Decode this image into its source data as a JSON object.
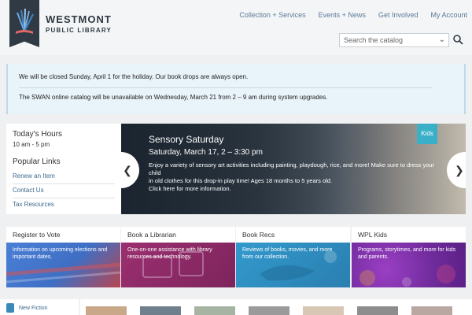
{
  "header": {
    "logo_title": "WESTMONT",
    "logo_subtitle": "PUBLIC LIBRARY",
    "nav": [
      "Collection + Services",
      "Events + News",
      "Get Involved",
      "My Account"
    ],
    "search_placeholder": "Search the catalog"
  },
  "alert": {
    "line1": "We will be closed Sunday, April 1 for the holiday. Our book drops are always open.",
    "line2": "The SWAN online catalog will be unavailable on Wednesday, March 21 from 2 – 9 am during system upgrades."
  },
  "sidebar": {
    "hours_title": "Today's Hours",
    "hours": "10 am - 5 pm",
    "links_title": "Popular Links",
    "links": [
      "Renew an Item",
      "Contact Us",
      "Tax Resources"
    ]
  },
  "carousel": {
    "title": "Sensory Saturday",
    "date": "Saturday, March 17, 2 – 3:30 pm",
    "desc_lines": [
      "Enjoy a variety of sensory art activities including painting, playdough, rice, and more! Make sure to dress your child",
      "in old clothes for this drop-in play time! Ages 18 months to 5 years old.",
      "Click here for more information."
    ],
    "tag": "Kids",
    "prev_icon": "chevron-left-icon",
    "next_icon": "chevron-right-icon"
  },
  "tiles": [
    {
      "title": "Register to Vote",
      "lines": [
        "Information on upcoming elections and",
        "important dates."
      ],
      "color": "#3f6fc4"
    },
    {
      "title": "Book a Librarian",
      "lines": [
        "One-on-one assistance with library",
        "resources and technology."
      ],
      "color": "#8c2a66"
    },
    {
      "title": "Book Recs",
      "lines": [
        "Reviews of books, movies, and more",
        "from our collection."
      ],
      "color": "#2a8cbf"
    },
    {
      "title": "WPL Kids",
      "lines": [
        "Programs, storytimes, and more for kids",
        "and parents."
      ],
      "color": "#7a2fa0"
    }
  ],
  "bottom": {
    "new_fiction": "New Fiction",
    "book_colors": [
      "#c8a888",
      "#6f7f8c",
      "#a7b4a4",
      "#9a9a9a",
      "#d9c7b5",
      "#8d8d8d",
      "#b9a7a2"
    ]
  }
}
